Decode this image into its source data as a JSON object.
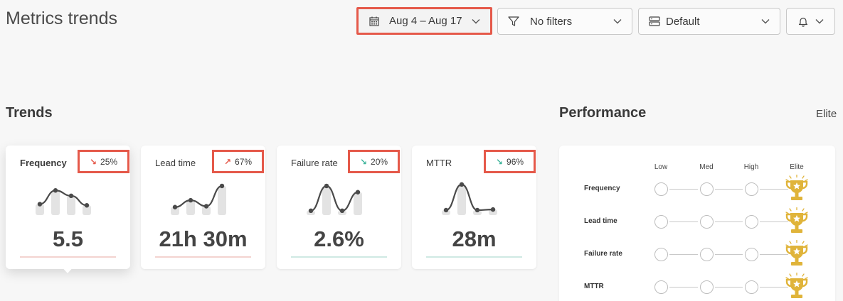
{
  "header": {
    "title": "Metrics trends",
    "date_range": "Aug 4 – Aug 17",
    "filters": "No filters",
    "view": "Default"
  },
  "trends": {
    "title": "Trends",
    "cards": [
      {
        "label": "Frequency",
        "delta": "25%",
        "direction": "down",
        "arrow": "↘",
        "arrow_color": "#e5594a",
        "value": "5.5",
        "underline_color": "#f3d3d0",
        "spark": [
          0.32,
          0.78,
          0.6,
          0.28
        ],
        "active": true
      },
      {
        "label": "Lead time",
        "delta": "67%",
        "direction": "up",
        "arrow": "↗",
        "arrow_color": "#e5594a",
        "value": "21h 30m",
        "underline_color": "#f3d3d0",
        "spark": [
          0.22,
          0.45,
          0.25,
          0.93
        ],
        "active": false
      },
      {
        "label": "Failure rate",
        "delta": "20%",
        "direction": "down",
        "arrow": "↘",
        "arrow_color": "#40b59c",
        "value": "2.6%",
        "underline_color": "#cfe9e3",
        "spark": [
          0.1,
          0.93,
          0.1,
          0.72
        ],
        "active": false
      },
      {
        "label": "MTTR",
        "delta": "96%",
        "direction": "down",
        "arrow": "↘",
        "arrow_color": "#40b59c",
        "value": "28m",
        "underline_color": "#cfe9e3",
        "spark": [
          0.12,
          0.98,
          0.12,
          0.14
        ],
        "active": false
      }
    ]
  },
  "performance": {
    "title": "Performance",
    "level": "Elite",
    "columns": [
      "Low",
      "Med",
      "High",
      "Elite"
    ],
    "rows": [
      "Frequency",
      "Lead time",
      "Failure rate",
      "MTTR"
    ],
    "row_level": [
      "Elite",
      "Elite",
      "Elite",
      "Elite"
    ]
  },
  "colors": {
    "highlight": "#e5594a",
    "trophy": "#e0b43a",
    "spark_line": "#4a4a4a",
    "spark_bar": "#e3e3e3"
  },
  "icons": [
    "calendar-icon",
    "chevron-down-icon",
    "filter-icon",
    "server-icon",
    "bell-icon",
    "trophy-icon"
  ]
}
